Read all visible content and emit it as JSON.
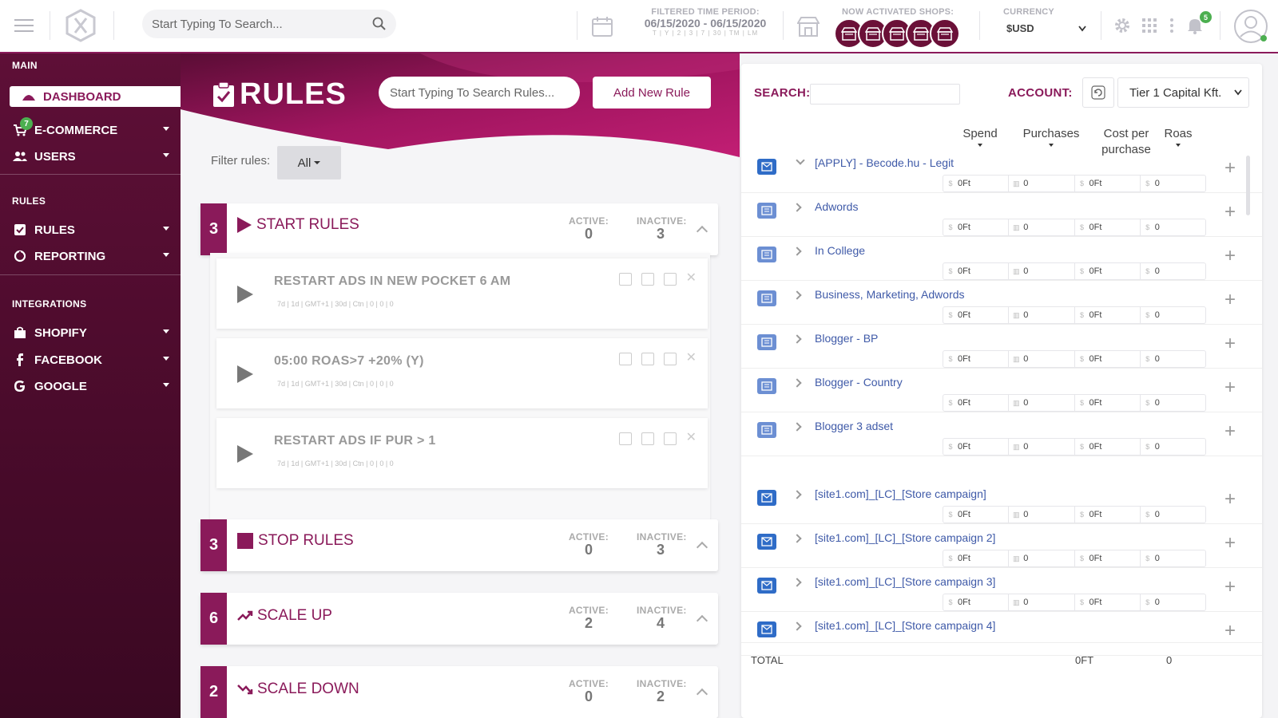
{
  "topbar": {
    "search_placeholder": "Start Typing To Search...",
    "period_label": "FILTERED TIME PERIOD:",
    "period_value": "06/15/2020 - 06/15/2020",
    "period_shortcuts": "T | Y | 2 | 3 | 7 | 30 | TM | LM",
    "shops_label": "NOW ACTIVATED SHOPS:",
    "currency_label": "CURRENCY",
    "currency_value": "$USD",
    "notification_count": "5",
    "colors": {
      "accent": "#8a1a5a",
      "dark": "#5e0f37",
      "badge": "#4caf50"
    }
  },
  "sidebar": {
    "main_label": "MAIN",
    "dashboard": "DASHBOARD",
    "ecommerce": "E-COMMERCE",
    "ecommerce_badge": "7",
    "users": "USERS",
    "rules_label": "RULES",
    "rules": "RULES",
    "reporting": "REPORTING",
    "integrations_label": "INTEGRATIONS",
    "shopify": "SHOPIFY",
    "facebook": "FACEBOOK",
    "google": "GOOGLE"
  },
  "main": {
    "title": "RULES",
    "search_placeholder": "Start Typing To Search Rules...",
    "add_button": "Add New Rule",
    "filter_label": "Filter rules:",
    "filter_value": "All",
    "active_label": "ACTIVE:",
    "inactive_label": "INACTIVE:",
    "groups": [
      {
        "count": "3",
        "title": "START RULES",
        "active": "0",
        "inactive": "3"
      },
      {
        "count": "3",
        "title": "STOP RULES",
        "active": "0",
        "inactive": "3"
      },
      {
        "count": "6",
        "title": "SCALE UP",
        "active": "2",
        "inactive": "4"
      },
      {
        "count": "2",
        "title": "SCALE DOWN",
        "active": "0",
        "inactive": "2"
      }
    ],
    "start_rules": [
      {
        "title": "RESTART ADS IN NEW POCKET 6 AM"
      },
      {
        "title": "05:00 ROAS>7 +20% (Y)"
      },
      {
        "title": "RESTART ADS IF PUR > 1"
      }
    ],
    "rule_meta": "7d  |  1d  |  GMT+1  |  30d  |  Ctn  |  0  |  0  |  0"
  },
  "panel": {
    "search_label": "SEARCH:",
    "account_label": "ACCOUNT:",
    "account_value": "Tier 1 Capital Kft.",
    "columns": {
      "spend": "Spend",
      "purchases": "Purchases",
      "cpp": "Cost per purchase",
      "roas": "Roas"
    },
    "rows": [
      {
        "name": "[APPLY] - Becode.hu - Legit",
        "spend": "0Ft",
        "purchases": "0",
        "cpp": "0Ft",
        "roas": "0"
      },
      {
        "name": "Adwords",
        "spend": "0Ft",
        "purchases": "0",
        "cpp": "0Ft",
        "roas": "0"
      },
      {
        "name": "In College",
        "spend": "0Ft",
        "purchases": "0",
        "cpp": "0Ft",
        "roas": "0"
      },
      {
        "name": "Business, Marketing, Adwords",
        "spend": "0Ft",
        "purchases": "0",
        "cpp": "0Ft",
        "roas": "0"
      },
      {
        "name": "Blogger - BP",
        "spend": "0Ft",
        "purchases": "0",
        "cpp": "0Ft",
        "roas": "0"
      },
      {
        "name": "Blogger - Country",
        "spend": "0Ft",
        "purchases": "0",
        "cpp": "0Ft",
        "roas": "0"
      },
      {
        "name": "Blogger 3 adset",
        "spend": "0Ft",
        "purchases": "0",
        "cpp": "0Ft",
        "roas": "0"
      },
      {
        "name": "[site1.com]_[LC]_[Store campaign]",
        "spend": "0Ft",
        "purchases": "0",
        "cpp": "0Ft",
        "roas": "0"
      },
      {
        "name": "[site1.com]_[LC]_[Store campaign 2]",
        "spend": "0Ft",
        "purchases": "0",
        "cpp": "0Ft",
        "roas": "0"
      },
      {
        "name": "[site1.com]_[LC]_[Store campaign 3]",
        "spend": "0Ft",
        "purchases": "0",
        "cpp": "0Ft",
        "roas": "0"
      },
      {
        "name": "[site1.com]_[LC]_[Store campaign 4]"
      }
    ],
    "total_label": "TOTAL",
    "total_spend": "0FT",
    "total_roas": "0"
  }
}
